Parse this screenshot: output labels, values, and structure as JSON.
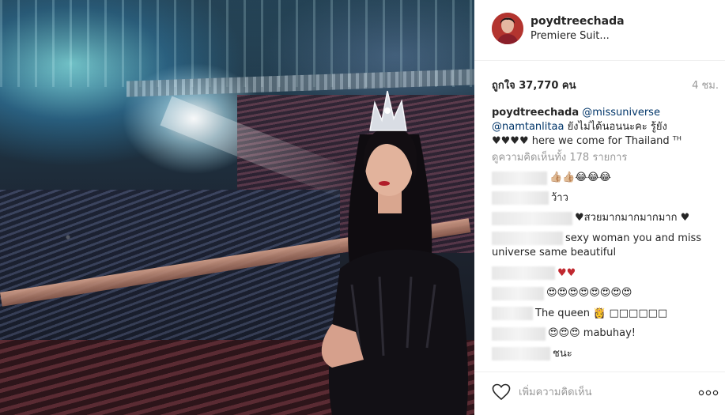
{
  "post": {
    "username": "poydtreechada",
    "location": "Premiere Suit...",
    "likes": "ถูกใจ 37,770 คน",
    "time_ago": "4 ชม."
  },
  "caption": {
    "user": "poydtreechada",
    "mention_1": "@missuniverse",
    "mention_2": "@namtanlitaa",
    "text_1": " ยังไม่ได้นอนนะคะ รู้ยัง",
    "text_2": "♥♥♥♥ here we come for Thailand ᵀᴴ"
  },
  "view_all_comments": "ดูความคิดเห็นทั้ง 178 รายการ",
  "comments": [
    {
      "text": "👍🏼👍🏼😂😂😂"
    },
    {
      "text": "ว้าว"
    },
    {
      "text": "♥สวยมากมากมากมาก ♥"
    },
    {
      "text": "sexy woman you and miss universe same beautiful"
    },
    {
      "text": "♥♥"
    },
    {
      "text": "😍😍😍😍😍😍😍😍"
    },
    {
      "text": "The queen 👸 □□□□□□"
    },
    {
      "text": "😍😍😍 mabuhay!"
    },
    {
      "text": "ชนะ"
    }
  ],
  "footer": {
    "add_comment_placeholder": "เพิ่มความคิดเห็น"
  },
  "colors": {
    "link": "#003569",
    "muted": "#999999",
    "divider": "#efefef",
    "heart_outline": "#262626"
  }
}
